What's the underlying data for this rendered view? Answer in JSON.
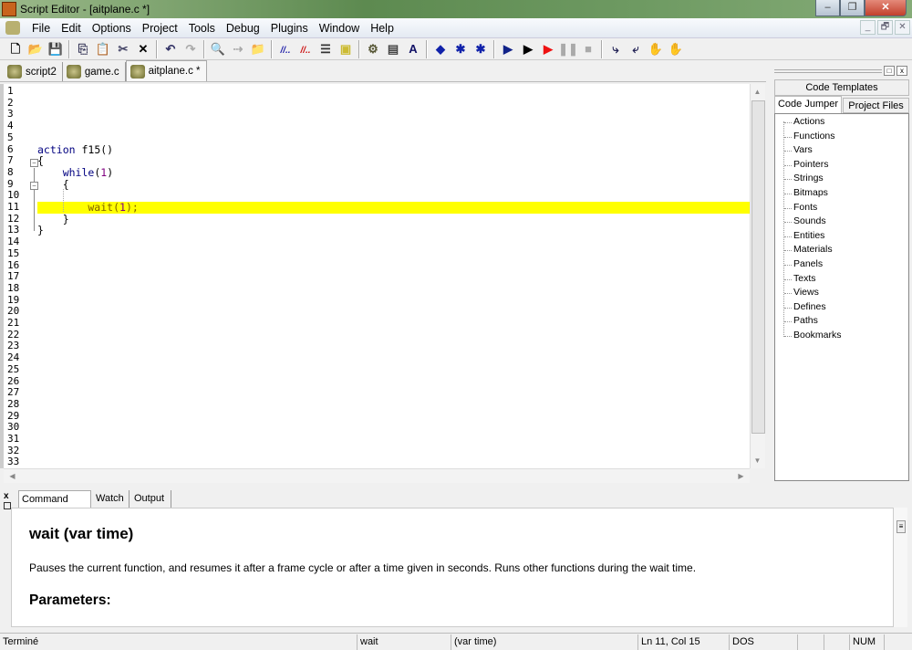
{
  "window": {
    "title": "Script Editor - [aitplane.c *]",
    "minimize": "–",
    "restore": "❐",
    "close": "✕"
  },
  "menu": [
    "File",
    "Edit",
    "Options",
    "Project",
    "Tools",
    "Debug",
    "Plugins",
    "Window",
    "Help"
  ],
  "mdi": {
    "minimize": "_",
    "restore": "🗗",
    "close": "✕"
  },
  "toolbar": [
    {
      "name": "new-file",
      "g": "🗋",
      "c": "#000"
    },
    {
      "name": "open-file",
      "g": "📂",
      "c": "#b80"
    },
    {
      "name": "save",
      "g": "💾",
      "c": "#333"
    },
    "|",
    {
      "name": "copy",
      "g": "⎘",
      "c": "#335"
    },
    {
      "name": "paste",
      "g": "📋",
      "c": "#999"
    },
    {
      "name": "cut",
      "g": "✂",
      "c": "#446"
    },
    {
      "name": "delete",
      "g": "✕",
      "c": "#000"
    },
    "|",
    {
      "name": "undo",
      "g": "↶",
      "c": "#336"
    },
    {
      "name": "redo",
      "g": "↷",
      "c": "#aaa"
    },
    "|",
    {
      "name": "find",
      "g": "🔍",
      "c": "#000"
    },
    {
      "name": "replace",
      "g": "⇢",
      "c": "#aaa"
    },
    {
      "name": "find-in-files",
      "g": "📁",
      "c": "#b80"
    },
    "|",
    {
      "name": "comment",
      "g": "//..",
      "c": "#22a"
    },
    {
      "name": "uncomment",
      "g": "//..",
      "c": "#c11"
    },
    {
      "name": "indent",
      "g": "☰",
      "c": "#333"
    },
    {
      "name": "bookmark",
      "g": "▣",
      "c": "#cb3"
    },
    "|",
    {
      "name": "compile",
      "g": "⚙",
      "c": "#553"
    },
    {
      "name": "properties",
      "g": "▤",
      "c": "#444"
    },
    {
      "name": "font",
      "g": "A",
      "c": "#116"
    },
    "|",
    {
      "name": "breakpoint",
      "g": "◆",
      "c": "#12a"
    },
    {
      "name": "add-breakpoint",
      "g": "✱",
      "c": "#12a"
    },
    {
      "name": "remove-breakpoint",
      "g": "✱",
      "c": "#12a"
    },
    "|",
    {
      "name": "run",
      "g": "▶",
      "c": "#128"
    },
    {
      "name": "step",
      "g": "▶",
      "c": "#000"
    },
    {
      "name": "run-debug",
      "g": "▶",
      "c": "#e11"
    },
    {
      "name": "pause",
      "g": "❚❚",
      "c": "#aaa"
    },
    {
      "name": "stop",
      "g": "■",
      "c": "#aaa"
    },
    "|",
    {
      "name": "step-into",
      "g": "⤷",
      "c": "#225"
    },
    {
      "name": "step-over",
      "g": "⤶",
      "c": "#225"
    },
    {
      "name": "hand",
      "g": "✋",
      "c": "#333"
    },
    {
      "name": "hand-disabled",
      "g": "✋",
      "c": "#aaa"
    }
  ],
  "file_tabs": [
    {
      "label": "script2",
      "active": false
    },
    {
      "label": "game.c",
      "active": false
    },
    {
      "label": "aitplane.c *",
      "active": true
    }
  ],
  "editor": {
    "line_count": 33,
    "highlight_line": 11,
    "lines": {
      "6": [
        {
          "t": "action",
          "c": "#000080"
        },
        {
          "t": " f15()",
          "c": "#000"
        }
      ],
      "7": [
        {
          "t": "{",
          "c": "#000"
        }
      ],
      "8": [
        {
          "t": "    while",
          "c": "#000080"
        },
        {
          "t": "(",
          "c": "#000"
        },
        {
          "t": "1",
          "c": "#800080"
        },
        {
          "t": ")",
          "c": "#000"
        }
      ],
      "9": [
        {
          "t": "    {",
          "c": "#000"
        }
      ],
      "11": [
        {
          "t": "        wait(",
          "c": "#806000"
        },
        {
          "t": "1",
          "c": "#800080"
        },
        {
          "t": ");",
          "c": "#806000"
        }
      ],
      "12": [
        {
          "t": "    }",
          "c": "#000"
        }
      ],
      "13": [
        {
          "t": "}",
          "c": "#000"
        }
      ]
    }
  },
  "right_panel": {
    "tabs": {
      "templates": "Code Templates",
      "jumper": "Code Jumper",
      "files": "Project Files"
    },
    "items": [
      "Actions",
      "Functions",
      "Vars",
      "Pointers",
      "Strings",
      "Bitmaps",
      "Fonts",
      "Sounds",
      "Entities",
      "Materials",
      "Panels",
      "Texts",
      "Views",
      "Defines",
      "Paths",
      "Bookmarks"
    ]
  },
  "bottom_panel": {
    "tabs": [
      "Command Help",
      "Watch",
      "Output"
    ],
    "help": {
      "title": "wait (var time)",
      "description": "Pauses the current function, and resumes it after a frame cycle or after a time given in seconds. Runs other functions during the wait time.",
      "section": "Parameters:"
    }
  },
  "status": {
    "message": "Terminé",
    "keyword": "wait",
    "signature": "(var time)",
    "position": "Ln 11, Col 15",
    "format": "DOS",
    "num": "NUM"
  }
}
